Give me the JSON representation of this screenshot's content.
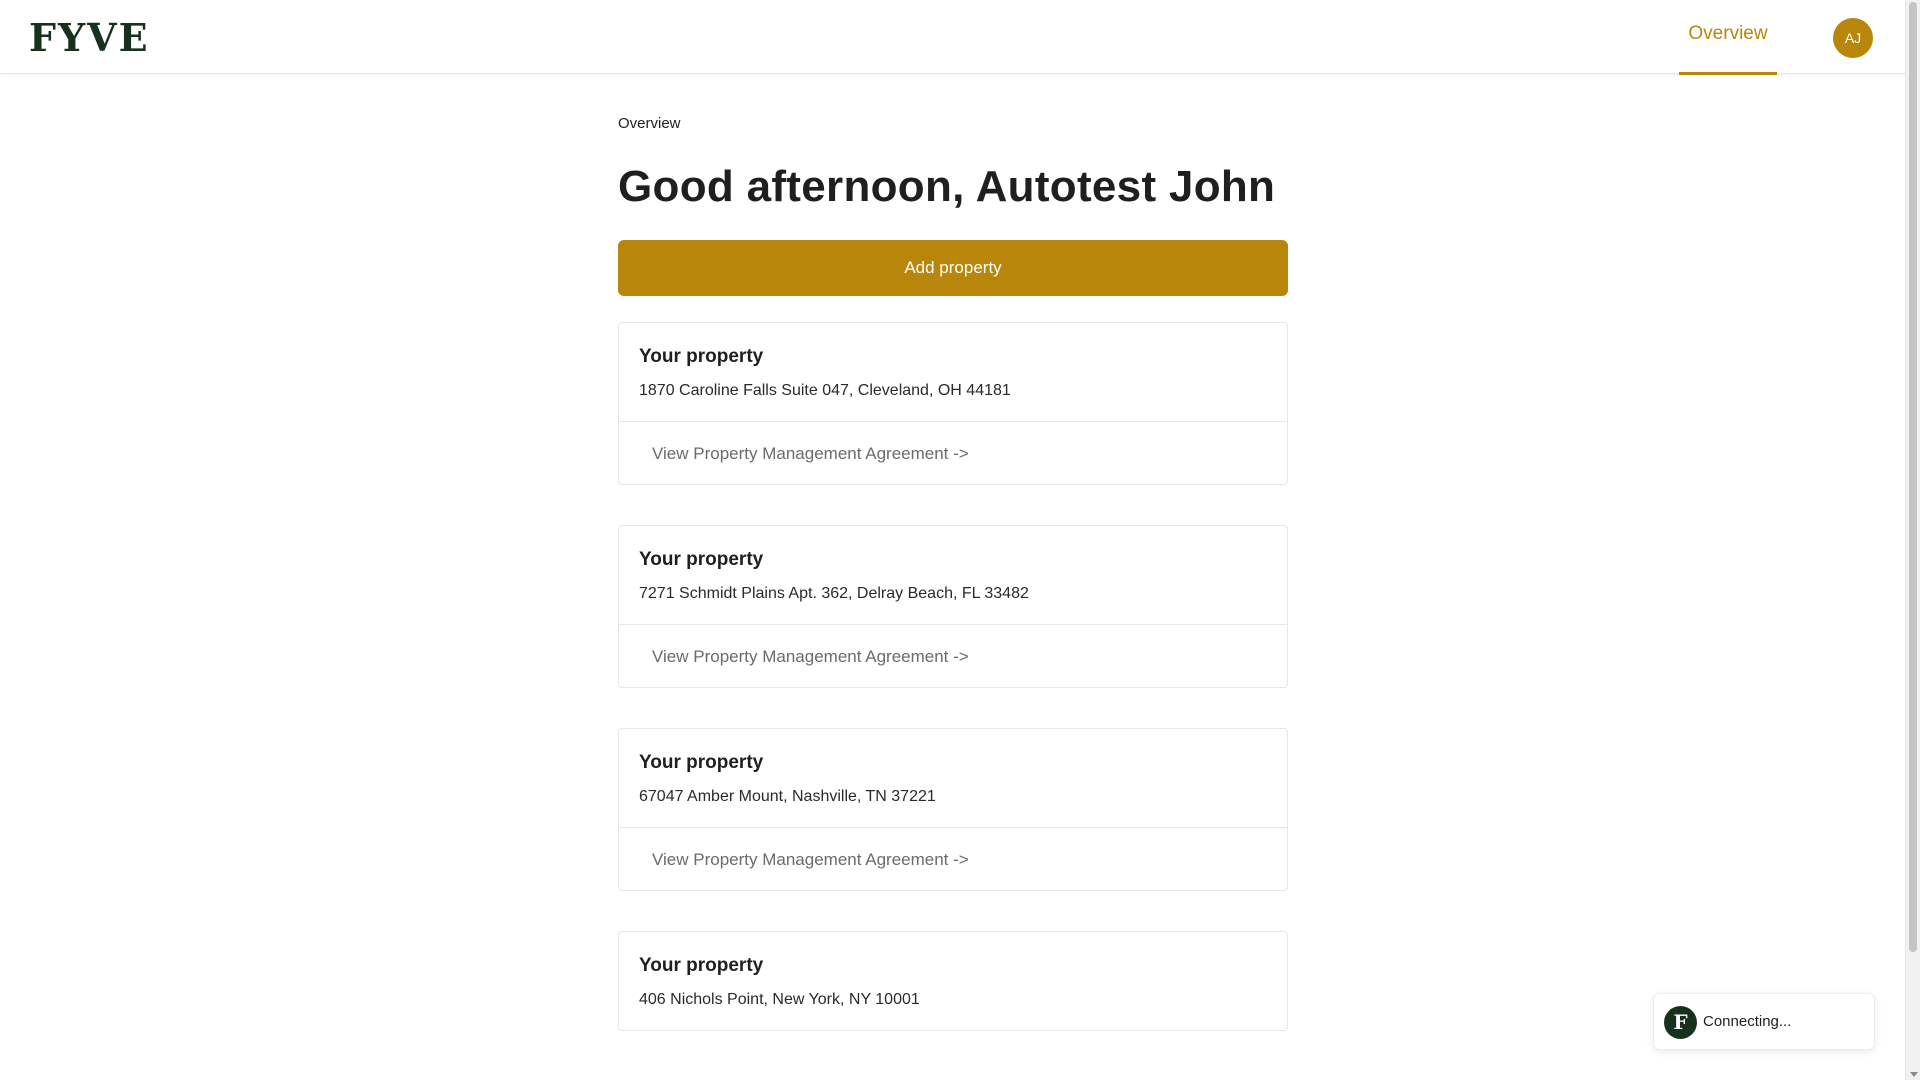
{
  "header": {
    "logo_text": "FYVE",
    "nav_tab_label": "Overview",
    "avatar_initials": "AJ"
  },
  "main": {
    "breadcrumb": "Overview",
    "greeting": "Good afternoon, Autotest John",
    "add_property_label": "Add property",
    "properties": [
      {
        "title": "Your property",
        "address": "1870 Caroline Falls Suite 047, Cleveland, OH 44181",
        "link_label": "View Property Management Agreement ->"
      },
      {
        "title": "Your property",
        "address": "7271 Schmidt Plains Apt. 362, Delray Beach, FL 33482",
        "link_label": "View Property Management Agreement ->"
      },
      {
        "title": "Your property",
        "address": "67047 Amber Mount, Nashville, TN 37221",
        "link_label": "View Property Management Agreement ->"
      },
      {
        "title": "Your property",
        "address": "406 Nichols Point, New York, NY 10001"
      }
    ]
  },
  "toast": {
    "icon_letter": "F",
    "status_text": "Connecting..."
  },
  "colors": {
    "accent": "#b8860b",
    "brand": "#17321c"
  }
}
